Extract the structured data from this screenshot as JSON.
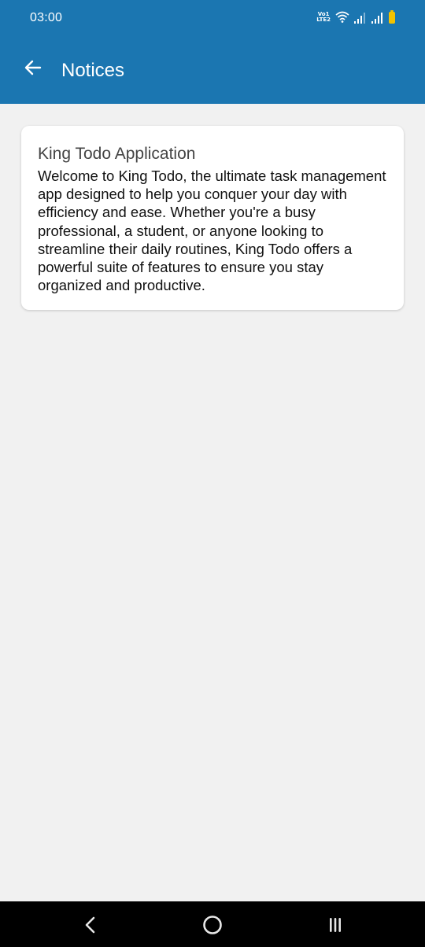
{
  "status_bar": {
    "time": "03:00",
    "volte_top": "Vo1",
    "volte_bottom": "LTE2",
    "icons": [
      "volte-lte-icon",
      "wifi-icon",
      "signal-icon-sim1",
      "signal-icon-sim2",
      "battery-icon"
    ],
    "battery_color": "#f2c200"
  },
  "app_bar": {
    "back_icon": "arrow-left-icon",
    "title": "Notices",
    "background": "#1b76b1"
  },
  "notices": [
    {
      "title": "King Todo Application",
      "body": "Welcome to King Todo, the ultimate task management app designed to help you conquer your day with efficiency and ease. Whether you're a busy professional, a student, or anyone looking to streamline their daily routines, King Todo offers a powerful suite of features to ensure you stay organized and productive."
    }
  ],
  "nav_bar": {
    "back_icon": "chevron-left-icon",
    "home_icon": "circle-home-icon",
    "recents_icon": "recents-icon"
  }
}
